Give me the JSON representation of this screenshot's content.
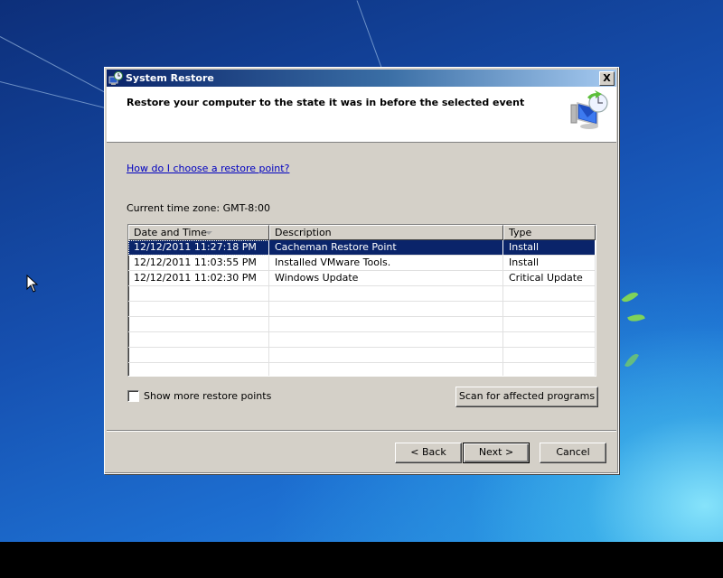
{
  "window": {
    "title": "System Restore",
    "close_label": "X",
    "header_title": "Restore your computer to the state it was in before the selected event"
  },
  "help_link": "How do I choose a restore point?",
  "timezone": "Current time zone: GMT-8:00",
  "restore_points": {
    "columns": [
      "Date and Time",
      "Description",
      "Type"
    ],
    "sort_column": "Date and Time",
    "sort_direction": "descending",
    "rows": [
      {
        "date": "12/12/2011 11:27:18 PM",
        "description": "Cacheman Restore Point",
        "type": "Install",
        "selected": true
      },
      {
        "date": "12/12/2011 11:03:55 PM",
        "description": "Installed VMware Tools.",
        "type": "Install",
        "selected": false
      },
      {
        "date": "12/12/2011 11:02:30 PM",
        "description": "Windows Update",
        "type": "Critical Update",
        "selected": false
      }
    ],
    "empty_rows": 6
  },
  "show_more": {
    "label": "Show more restore points",
    "checked": false
  },
  "buttons": {
    "scan": "Scan for affected programs",
    "back": "< Back",
    "next": "Next >",
    "cancel": "Cancel"
  },
  "colors": {
    "selection": "#0a246a",
    "dialog_face": "#d4d0c8",
    "link": "#0000c0"
  }
}
